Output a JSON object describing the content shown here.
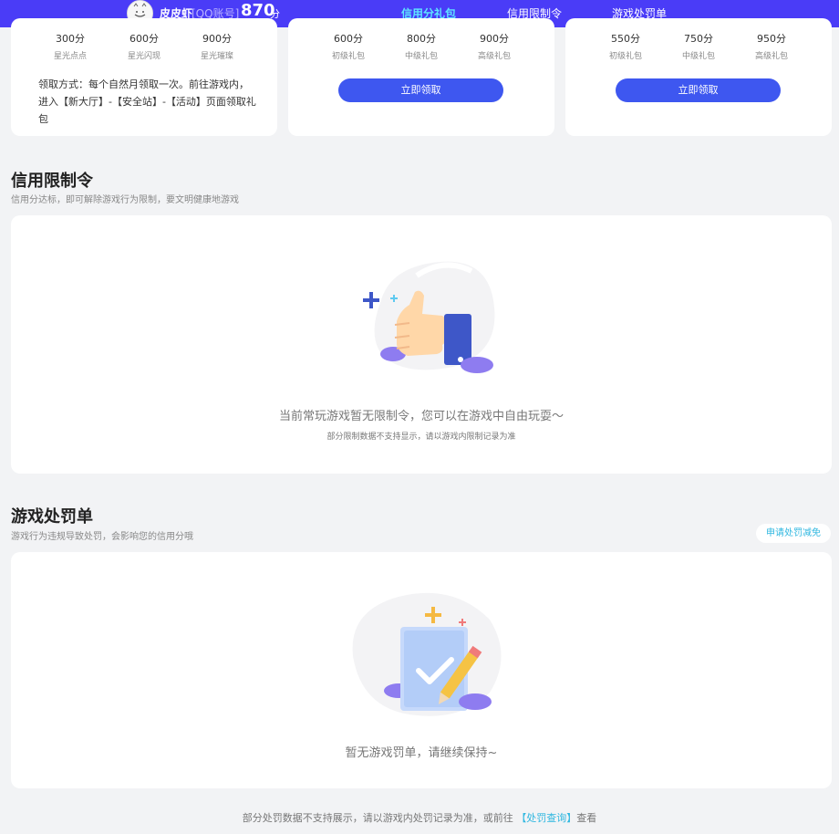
{
  "header": {
    "nickname": "皮皮虾",
    "account_type": "[QQ账号]",
    "score": "870",
    "score_unit": "分",
    "tabs": [
      {
        "label": "信用分礼包",
        "active": true
      },
      {
        "label": "信用限制令",
        "active": false
      },
      {
        "label": "游戏处罚单",
        "active": false
      }
    ]
  },
  "gift_cards": [
    {
      "tiers": [
        {
          "value": "300分",
          "name": "星光点点"
        },
        {
          "value": "600分",
          "name": "星光闪现"
        },
        {
          "value": "900分",
          "name": "星光璀璨"
        }
      ],
      "claim_text": "领取方式：每个自然月领取一次。前往游戏内，进入【新大厅】-【安全站】-【活动】页面领取礼包"
    },
    {
      "tiers": [
        {
          "value": "600分",
          "name": "初级礼包"
        },
        {
          "value": "800分",
          "name": "中级礼包"
        },
        {
          "value": "900分",
          "name": "高级礼包"
        }
      ],
      "button": "立即领取"
    },
    {
      "tiers": [
        {
          "value": "550分",
          "name": "初级礼包"
        },
        {
          "value": "750分",
          "name": "中级礼包"
        },
        {
          "value": "950分",
          "name": "高级礼包"
        }
      ],
      "button": "立即领取"
    }
  ],
  "restriction": {
    "title": "信用限制令",
    "subtitle": "信用分达标，即可解除游戏行为限制，要文明健康地游戏",
    "empty_main": "当前常玩游戏暂无限制令，您可以在游戏中自由玩耍～",
    "empty_sub": "部分限制数据不支持显示，请以游戏内限制记录为准"
  },
  "penalty": {
    "title": "游戏处罚单",
    "subtitle": "游戏行为违规导致处罚，会影响您的信用分哦",
    "apply_button": "申请处罚减免",
    "empty_main": "暂无游戏罚单，请继续保持~"
  },
  "footer": {
    "text_before": "部分处罚数据不支持展示，请以游戏内处罚记录为准，或前往",
    "link": "【处罚查询】",
    "text_after": "查看"
  },
  "colors": {
    "topbar": "#4a3cf7",
    "accent_cyan": "#5ee6ff",
    "button": "#3e57f0",
    "link": "#2fb7e0"
  }
}
